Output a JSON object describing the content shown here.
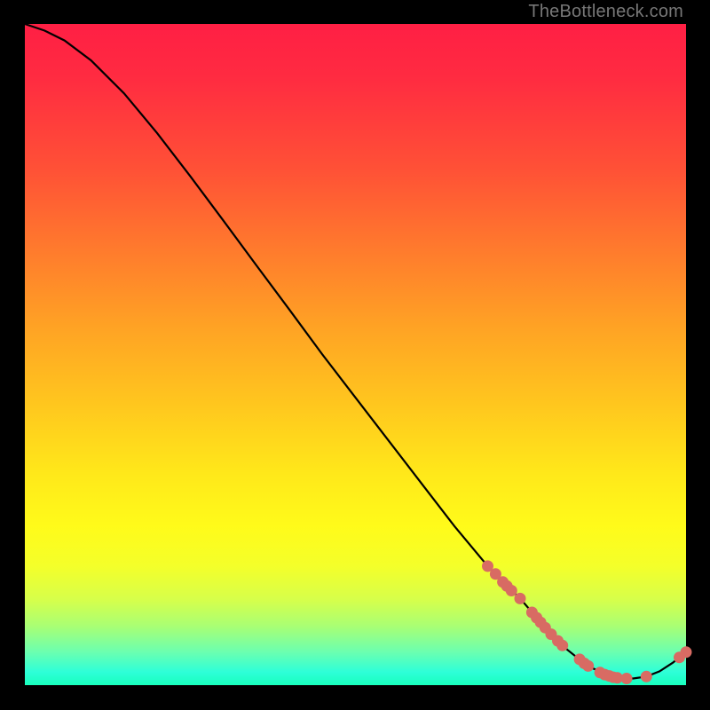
{
  "watermark": "TheBottleneck.com",
  "colors": {
    "curve": "#000000",
    "marker_fill": "#d86b63",
    "marker_stroke": "#b94f48"
  },
  "chart_data": {
    "type": "line",
    "title": "",
    "xlabel": "",
    "ylabel": "",
    "xlim": [
      0,
      100
    ],
    "ylim": [
      0,
      100
    ],
    "series": [
      {
        "name": "curve",
        "x": [
          0,
          3,
          6,
          10,
          15,
          20,
          25,
          30,
          35,
          40,
          45,
          50,
          55,
          60,
          65,
          70,
          75,
          78,
          80,
          82,
          84,
          86,
          88,
          90,
          92,
          94,
          96,
          98,
          100
        ],
        "y": [
          100,
          99,
          97.5,
          94.5,
          89.5,
          83.5,
          77,
          70.3,
          63.5,
          56.8,
          50,
          43.5,
          37,
          30.5,
          24,
          18,
          13,
          9.5,
          7.3,
          5.4,
          3.8,
          2.5,
          1.6,
          1.1,
          1.0,
          1.3,
          2.1,
          3.4,
          5.0
        ]
      }
    ],
    "markers": [
      {
        "x": 70.0,
        "y": 18.0
      },
      {
        "x": 71.2,
        "y": 16.8
      },
      {
        "x": 72.3,
        "y": 15.6
      },
      {
        "x": 72.9,
        "y": 15.0
      },
      {
        "x": 73.6,
        "y": 14.3
      },
      {
        "x": 74.9,
        "y": 13.1
      },
      {
        "x": 76.7,
        "y": 11.0
      },
      {
        "x": 77.4,
        "y": 10.2
      },
      {
        "x": 78.0,
        "y": 9.5
      },
      {
        "x": 78.7,
        "y": 8.7
      },
      {
        "x": 79.6,
        "y": 7.7
      },
      {
        "x": 80.6,
        "y": 6.7
      },
      {
        "x": 81.3,
        "y": 6.0
      },
      {
        "x": 83.9,
        "y": 3.9
      },
      {
        "x": 84.6,
        "y": 3.3
      },
      {
        "x": 85.2,
        "y": 2.9
      },
      {
        "x": 87.0,
        "y": 1.9
      },
      {
        "x": 87.7,
        "y": 1.6
      },
      {
        "x": 88.4,
        "y": 1.4
      },
      {
        "x": 89.0,
        "y": 1.2
      },
      {
        "x": 89.6,
        "y": 1.1
      },
      {
        "x": 91.0,
        "y": 1.0
      },
      {
        "x": 94.0,
        "y": 1.3
      },
      {
        "x": 99.0,
        "y": 4.2
      },
      {
        "x": 100.0,
        "y": 5.0
      }
    ]
  }
}
